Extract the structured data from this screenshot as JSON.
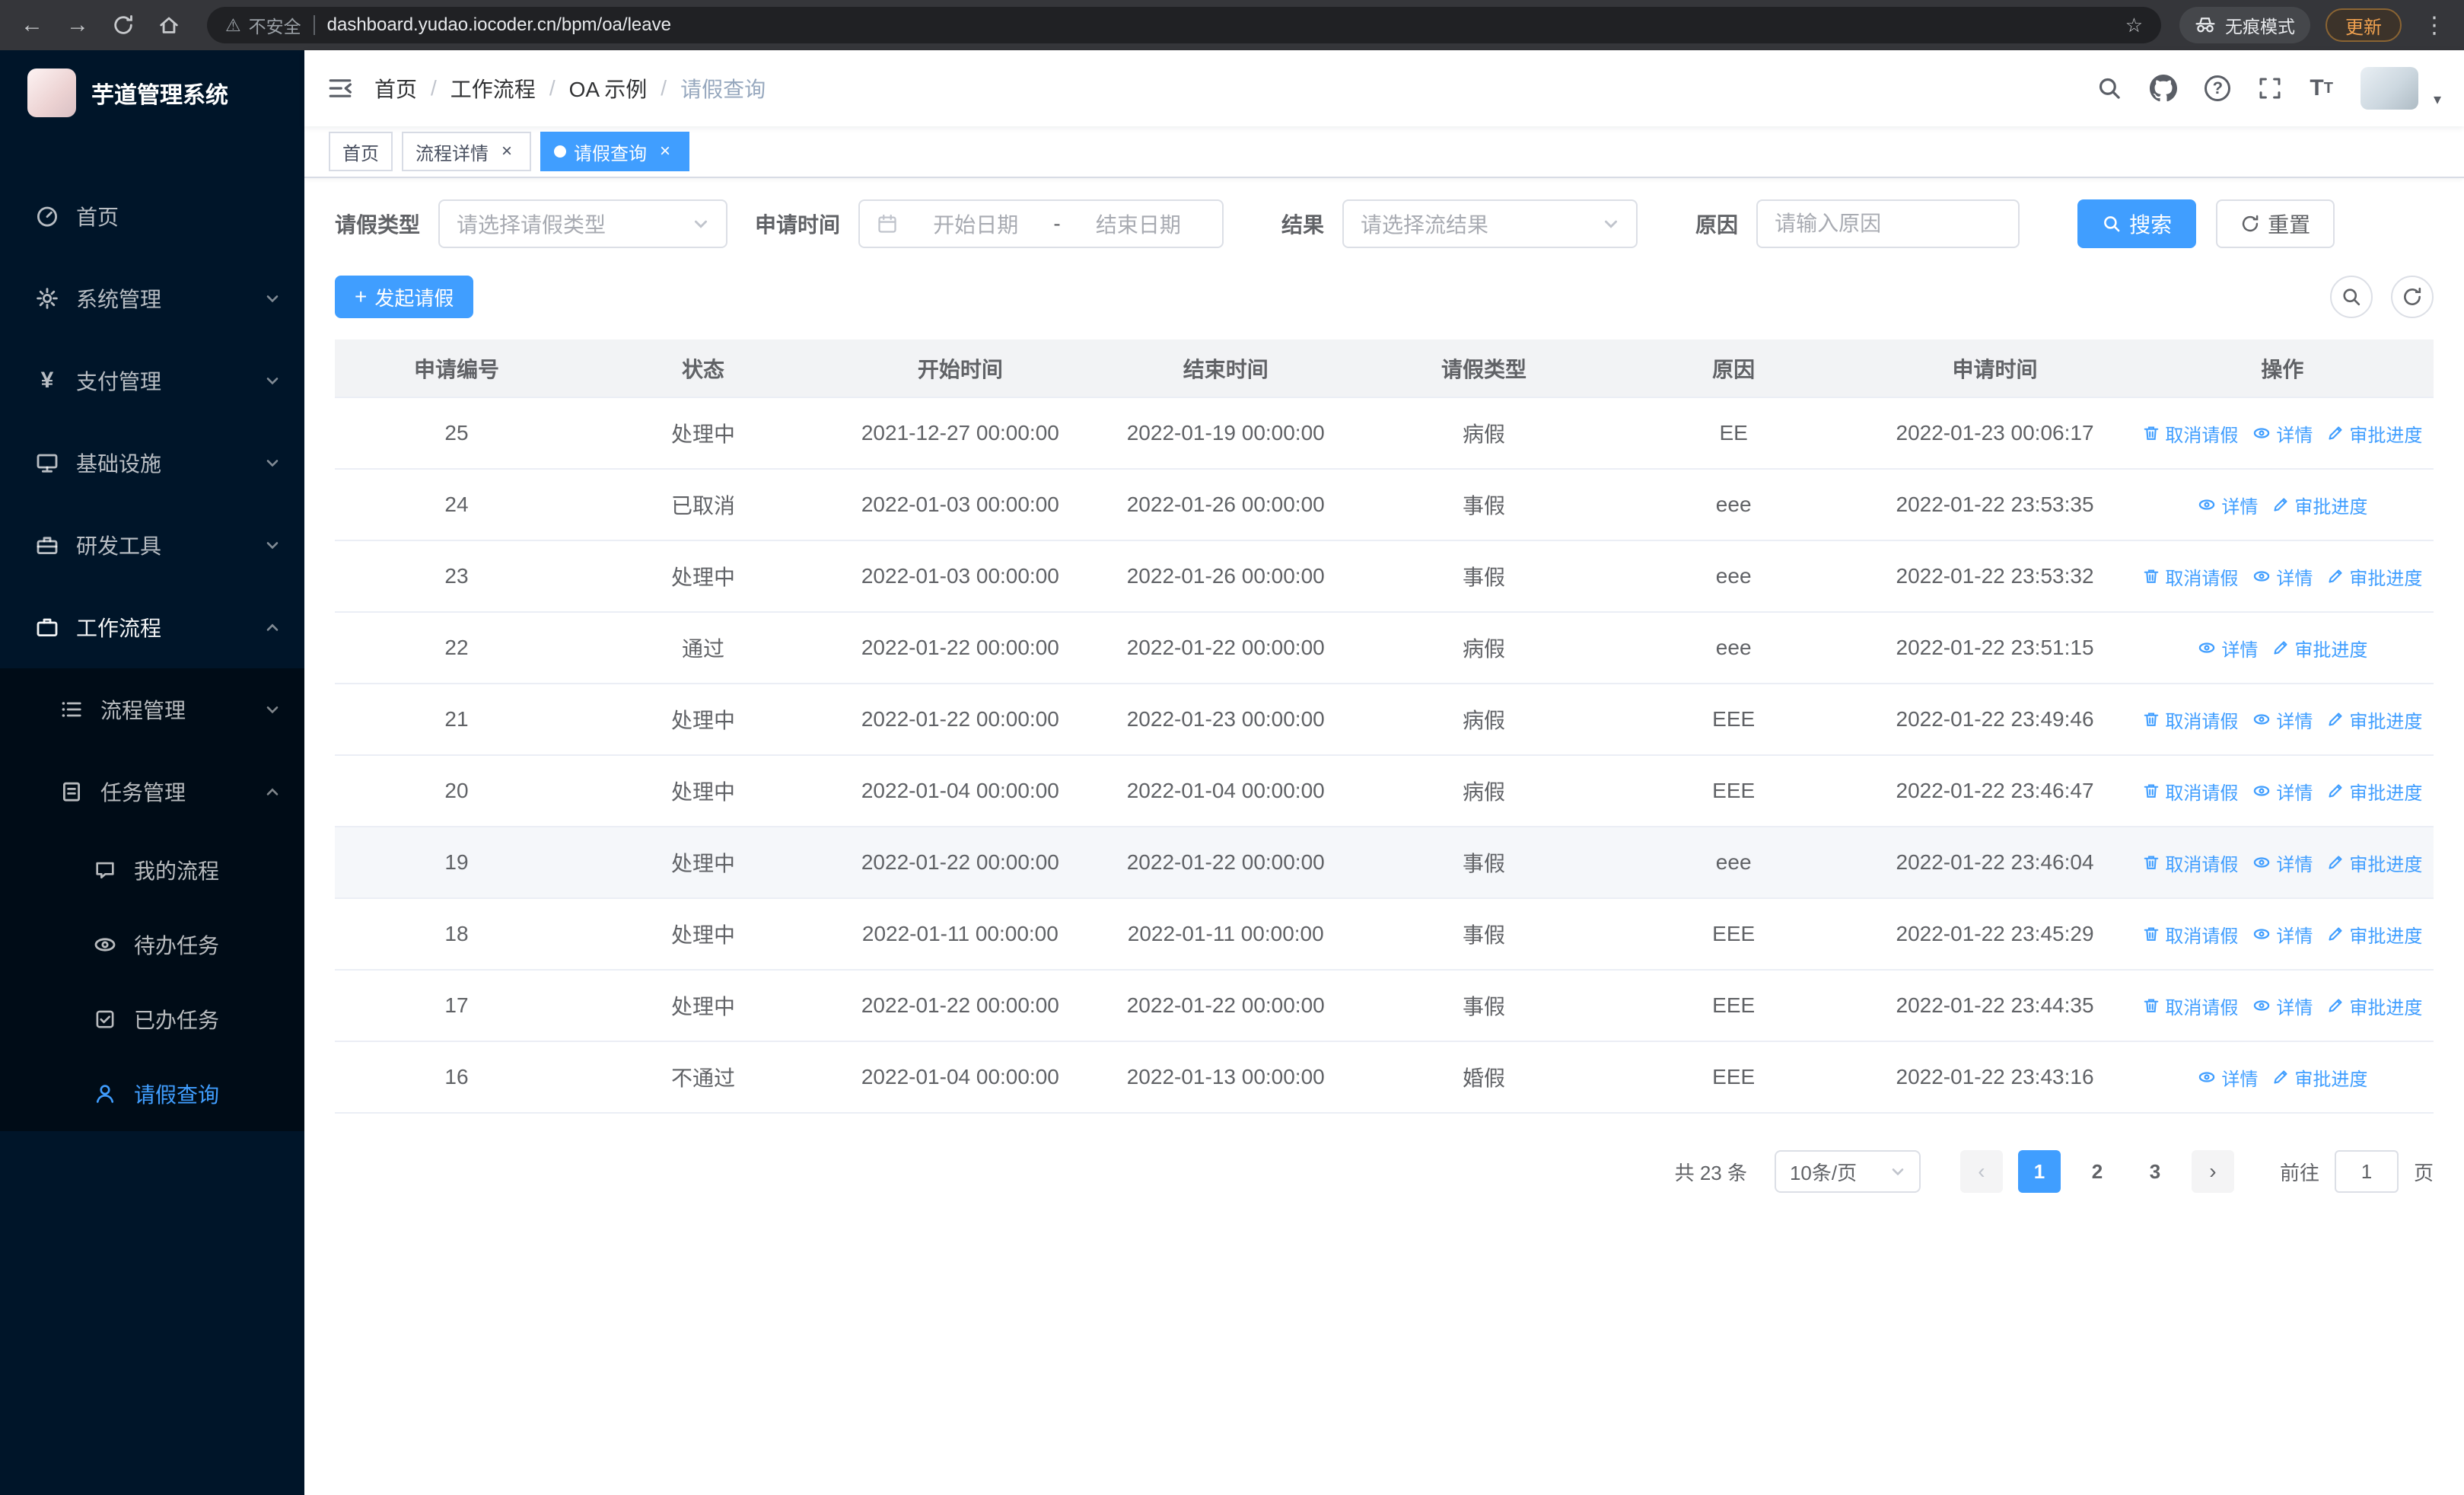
{
  "colors": {
    "primary": "#409eff",
    "sidebar_bg": "#001529",
    "submenu_bg": "#000c17"
  },
  "browser": {
    "warning": "不安全",
    "url": "dashboard.yudao.iocoder.cn/bpm/oa/leave",
    "incognito": "无痕模式",
    "update": "更新"
  },
  "sidebar": {
    "title": "芋道管理系统",
    "items": {
      "home": "首页",
      "system": "系统管理",
      "payment": "支付管理",
      "infra": "基础设施",
      "devtools": "研发工具",
      "workflow": "工作流程",
      "process": "流程管理",
      "task": "任务管理",
      "my_process": "我的流程",
      "todo": "待办任务",
      "done": "已办任务",
      "leave": "请假查询"
    }
  },
  "breadcrumb": [
    "首页",
    "工作流程",
    "OA 示例",
    "请假查询"
  ],
  "tabs": [
    {
      "label": "首页",
      "active": false
    },
    {
      "label": "流程详情",
      "active": false
    },
    {
      "label": "请假查询",
      "active": true
    }
  ],
  "filters": {
    "leave_type_label": "请假类型",
    "leave_type_placeholder": "请选择请假类型",
    "apply_time_label": "申请时间",
    "date_start_placeholder": "开始日期",
    "date_separator": "-",
    "date_end_placeholder": "结束日期",
    "result_label": "结果",
    "result_placeholder": "请选择流结果",
    "reason_label": "原因",
    "reason_placeholder": "请输入原因",
    "search": "搜索",
    "reset": "重置"
  },
  "toolbar": {
    "create": "发起请假"
  },
  "table": {
    "columns": [
      "申请编号",
      "状态",
      "开始时间",
      "结束时间",
      "请假类型",
      "原因",
      "申请时间",
      "操作"
    ],
    "action_labels": {
      "cancel": "取消请假",
      "detail": "详情",
      "progress": "审批进度"
    },
    "rows": [
      {
        "id": "25",
        "status": "处理中",
        "start": "2021-12-27 00:00:00",
        "end": "2022-01-19 00:00:00",
        "type": "病假",
        "reason": "EE",
        "applied": "2022-01-23 00:06:17",
        "cancel": true,
        "highlighted": false
      },
      {
        "id": "24",
        "status": "已取消",
        "start": "2022-01-03 00:00:00",
        "end": "2022-01-26 00:00:00",
        "type": "事假",
        "reason": "eee",
        "applied": "2022-01-22 23:53:35",
        "cancel": false,
        "highlighted": false
      },
      {
        "id": "23",
        "status": "处理中",
        "start": "2022-01-03 00:00:00",
        "end": "2022-01-26 00:00:00",
        "type": "事假",
        "reason": "eee",
        "applied": "2022-01-22 23:53:32",
        "cancel": true,
        "highlighted": false
      },
      {
        "id": "22",
        "status": "通过",
        "start": "2022-01-22 00:00:00",
        "end": "2022-01-22 00:00:00",
        "type": "病假",
        "reason": "eee",
        "applied": "2022-01-22 23:51:15",
        "cancel": false,
        "highlighted": false
      },
      {
        "id": "21",
        "status": "处理中",
        "start": "2022-01-22 00:00:00",
        "end": "2022-01-23 00:00:00",
        "type": "病假",
        "reason": "EEE",
        "applied": "2022-01-22 23:49:46",
        "cancel": true,
        "highlighted": false
      },
      {
        "id": "20",
        "status": "处理中",
        "start": "2022-01-04 00:00:00",
        "end": "2022-01-04 00:00:00",
        "type": "病假",
        "reason": "EEE",
        "applied": "2022-01-22 23:46:47",
        "cancel": true,
        "highlighted": false
      },
      {
        "id": "19",
        "status": "处理中",
        "start": "2022-01-22 00:00:00",
        "end": "2022-01-22 00:00:00",
        "type": "事假",
        "reason": "eee",
        "applied": "2022-01-22 23:46:04",
        "cancel": true,
        "highlighted": true
      },
      {
        "id": "18",
        "status": "处理中",
        "start": "2022-01-11 00:00:00",
        "end": "2022-01-11 00:00:00",
        "type": "事假",
        "reason": "EEE",
        "applied": "2022-01-22 23:45:29",
        "cancel": true,
        "highlighted": false
      },
      {
        "id": "17",
        "status": "处理中",
        "start": "2022-01-22 00:00:00",
        "end": "2022-01-22 00:00:00",
        "type": "事假",
        "reason": "EEE",
        "applied": "2022-01-22 23:44:35",
        "cancel": true,
        "highlighted": false
      },
      {
        "id": "16",
        "status": "不通过",
        "start": "2022-01-04 00:00:00",
        "end": "2022-01-13 00:00:00",
        "type": "婚假",
        "reason": "EEE",
        "applied": "2022-01-22 23:43:16",
        "cancel": false,
        "highlighted": false
      }
    ]
  },
  "pagination": {
    "total": "共 23 条",
    "page_size": "10条/页",
    "prev": "‹",
    "next": "›",
    "pages": [
      "1",
      "2",
      "3"
    ],
    "current": "1",
    "goto": "前往",
    "goto_value": "1",
    "page_unit": "页"
  }
}
